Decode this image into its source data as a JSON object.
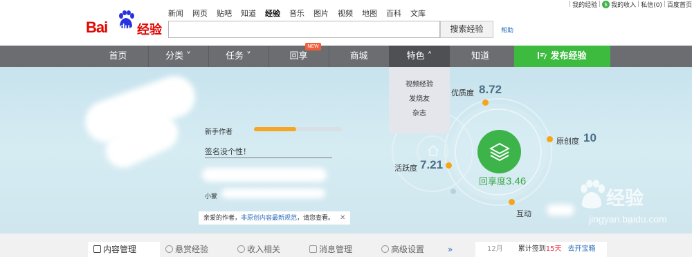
{
  "top_links": {
    "my_experience": "我的经验",
    "my_income": "我的收入",
    "messages": "私信(0)",
    "baidu_home": "百度首页",
    "pipe": "|",
    "coin": "$"
  },
  "logo": {
    "bai": "Bai",
    "du": "du",
    "jingyan": "经验"
  },
  "category_nav": [
    "新闻",
    "网页",
    "贴吧",
    "知道",
    "经验",
    "音乐",
    "图片",
    "视频",
    "地图",
    "百科",
    "文库"
  ],
  "category_active": "经验",
  "search": {
    "button_label": "搜索经验",
    "help": "帮助",
    "placeholder": ""
  },
  "main_nav": {
    "items": [
      "首页",
      "分类 ˅",
      "任务 ˅",
      "回享",
      "商城",
      "特色 ˄",
      "知道"
    ],
    "new_badge": "NEW",
    "publish_label": "发布经验",
    "selected": "特色 ˄"
  },
  "dropdown": {
    "items": [
      "视频经验",
      "发烧友",
      "杂志"
    ]
  },
  "profile": {
    "level_label": "新手作者",
    "level_progress": 0.48,
    "signature": "签名没个性！",
    "xiaomeng": "小蒙",
    "notice_prefix": "亲爱的作者，",
    "notice_link": "非原创内容最新规范",
    "notice_suffix": "，请您查看。",
    "notice_close": "✕"
  },
  "stats": {
    "quality_label": "优质度",
    "quality_value": "8.72",
    "originality_label": "原创度",
    "originality_value": "10",
    "activity_label": "活跃度",
    "activity_value": "7.21",
    "share_label": "回享度",
    "share_value": "3.46",
    "interaction_label": "互动"
  },
  "bottom_tabs": [
    "内容管理",
    "悬赏经验",
    "收入相关",
    "消息管理",
    "高级设置"
  ],
  "bottom_more": "»",
  "checkin": {
    "month": "12月",
    "text": "累计签到",
    "days": "15天",
    "open": "去开宝箱"
  },
  "watermark": {
    "text": "经验",
    "url": "jingyan.baidu.com"
  },
  "colors": {
    "brand_red": "#e10602",
    "nav_gray": "#6b6d70",
    "publish_green": "#3cbb3f",
    "accent_orange": "#f7a515",
    "link_blue": "#2f6fbd"
  }
}
